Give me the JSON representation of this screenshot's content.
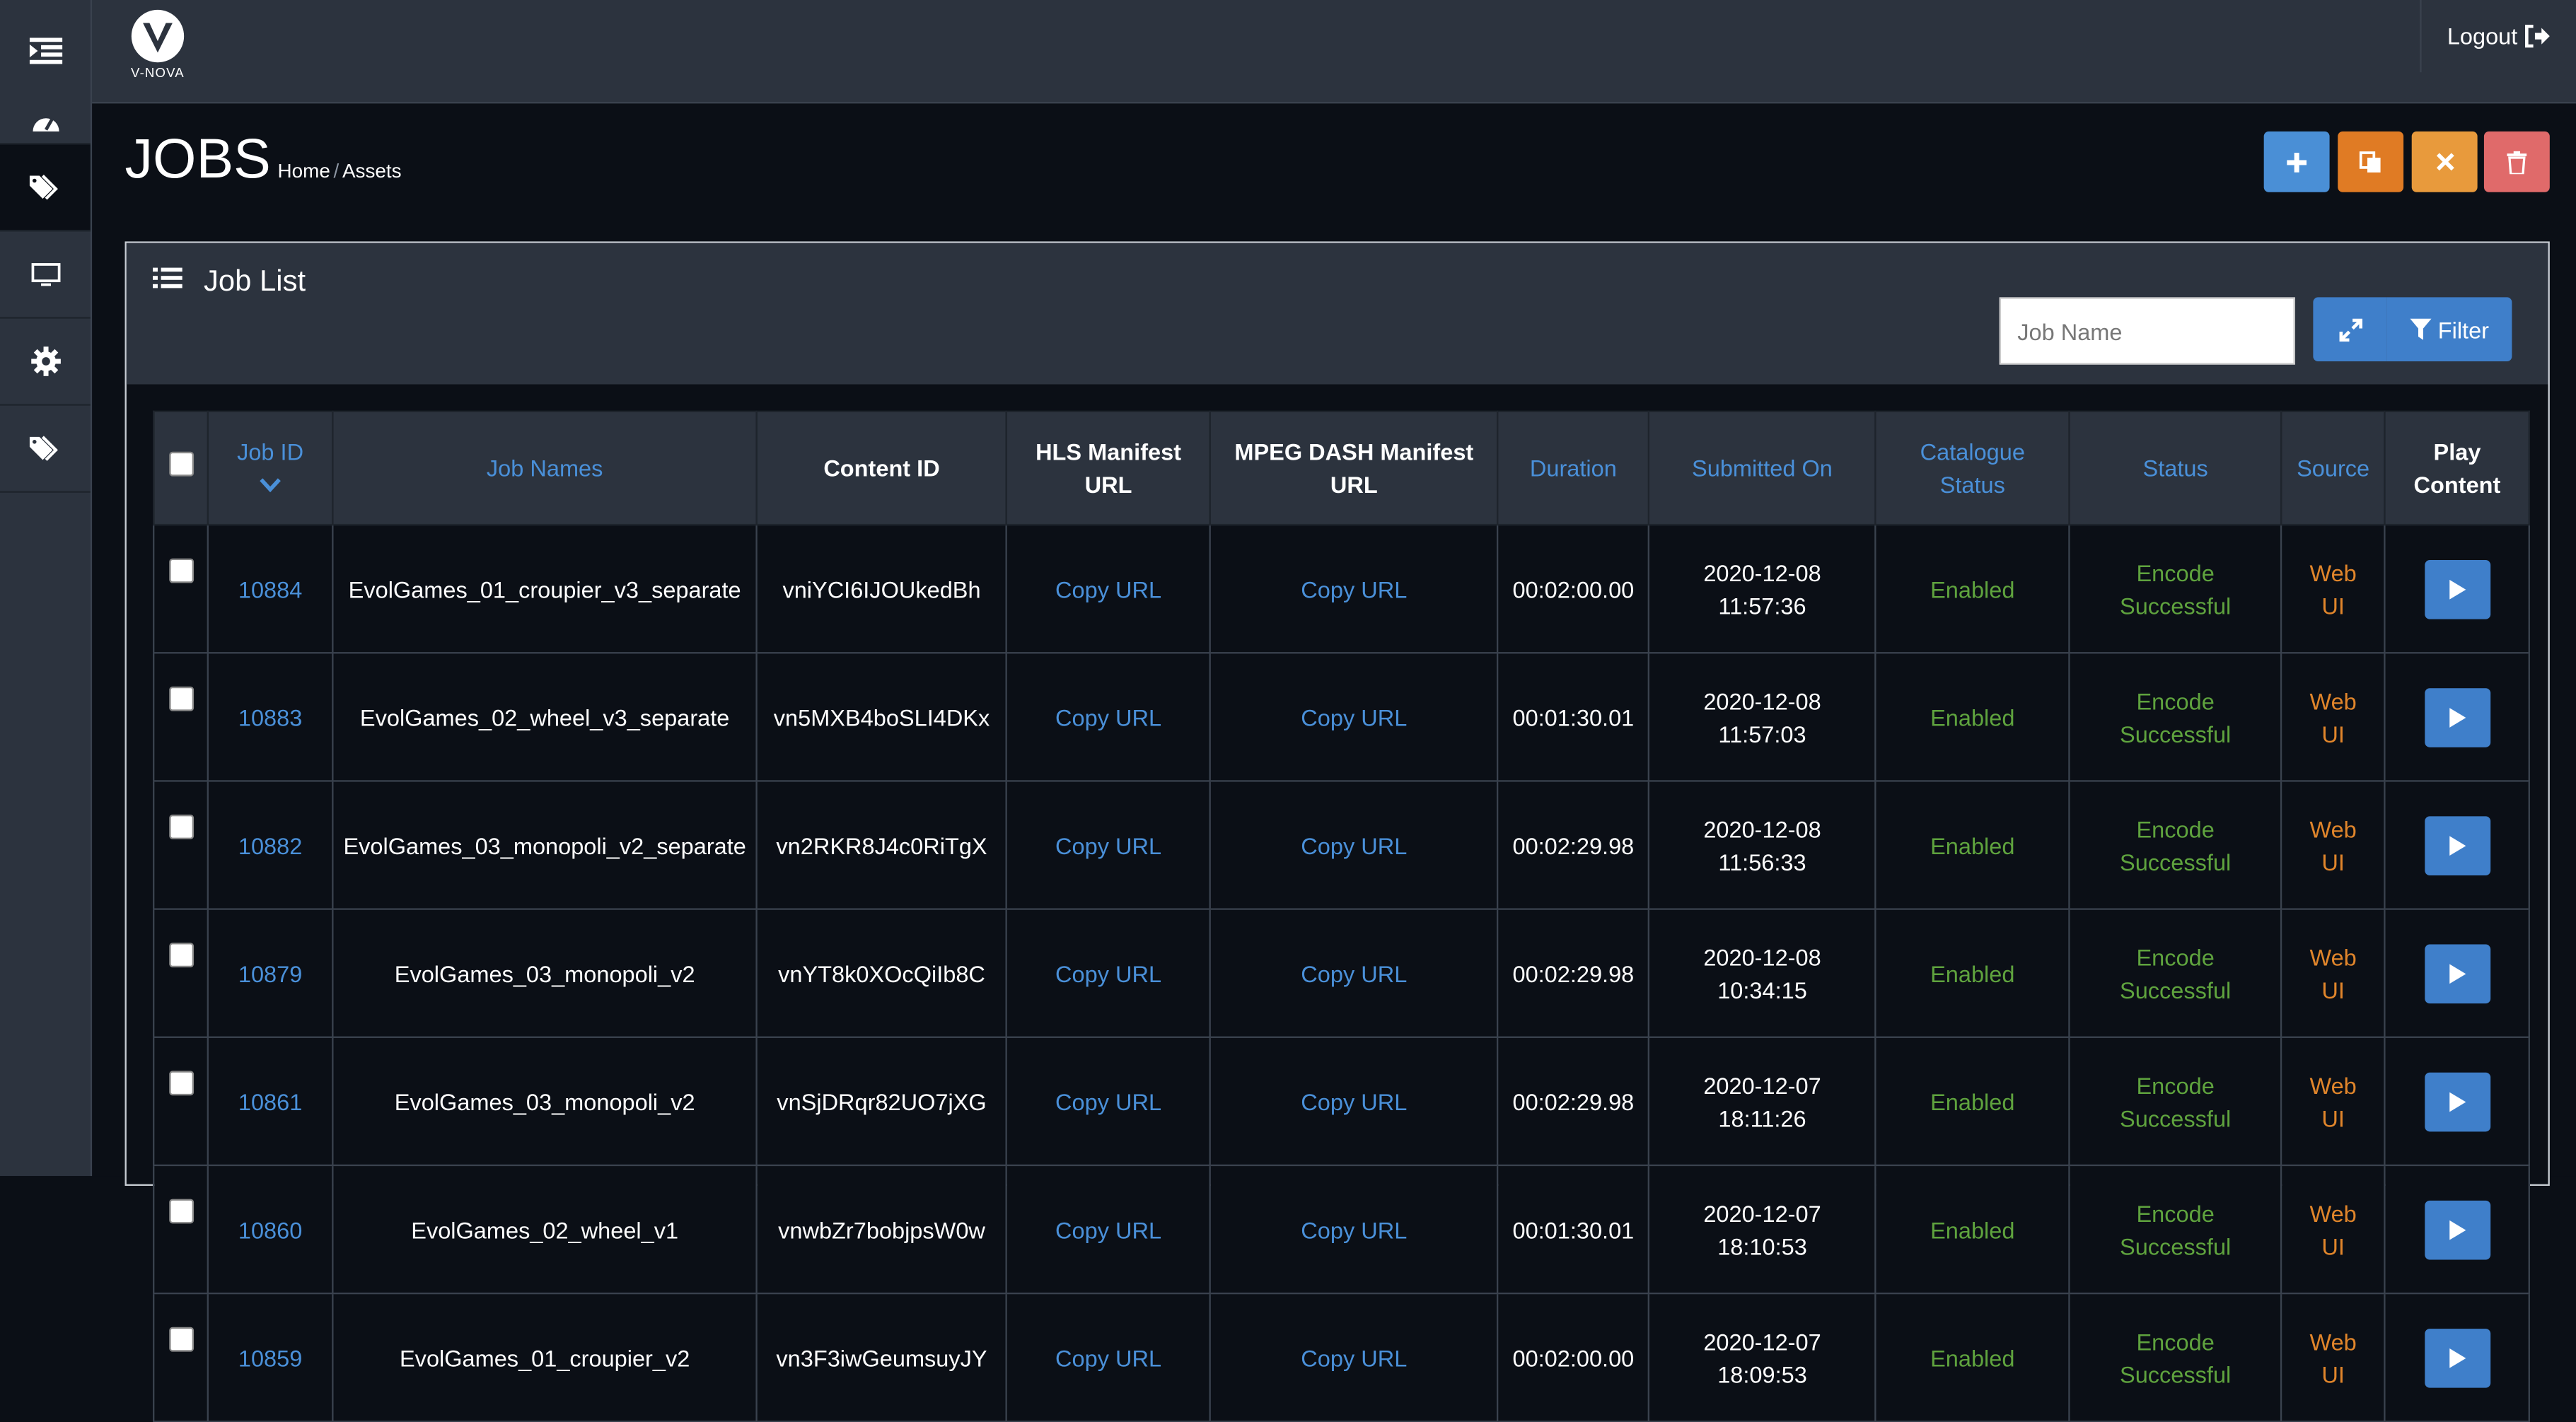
{
  "header": {
    "logo_text": "V-NOVA",
    "logout_label": "Logout"
  },
  "sidebar": {
    "items": [
      {
        "icon": "dashboard-icon"
      },
      {
        "icon": "tags-icon",
        "active": true
      },
      {
        "icon": "monitor-icon"
      },
      {
        "icon": "gear-icon"
      },
      {
        "icon": "tags-icon"
      }
    ]
  },
  "page": {
    "title": "JOBS",
    "breadcrumb": [
      "Home",
      "Assets"
    ]
  },
  "actions": {
    "add": {
      "icon": "plus-icon",
      "color": "#4a8fd6"
    },
    "copy": {
      "icon": "copy-icon",
      "color": "#e07b24"
    },
    "cancel": {
      "icon": "close-icon",
      "color": "#e89a3c"
    },
    "delete": {
      "icon": "trash-icon",
      "color": "#e06a6a"
    }
  },
  "panel": {
    "title": "Job List",
    "search_placeholder": "Job Name",
    "filter_label": "Filter"
  },
  "table": {
    "columns": {
      "job_id": "Job ID",
      "job_names": "Job Names",
      "content_id": "Content ID",
      "hls_l1": "HLS Manifest",
      "hls_l2": "URL",
      "dash_l1": "MPEG DASH Manifest",
      "dash_l2": "URL",
      "duration": "Duration",
      "submitted": "Submitted On",
      "catalogue_l1": "Catalogue",
      "catalogue_l2": "Status",
      "status": "Status",
      "source": "Source",
      "play_l1": "Play",
      "play_l2": "Content"
    },
    "rows": [
      {
        "id": "10884",
        "name": "EvolGames_01_croupier_v3_separate",
        "content_id": "vniYCI6IJOUkedBh",
        "hls": "Copy URL",
        "dash": "Copy URL",
        "duration": "00:02:00.00",
        "date": "2020-12-08",
        "time": "11:57:36",
        "catalogue": "Enabled",
        "status_l1": "Encode",
        "status_l2": "Successful",
        "source_l1": "Web",
        "source_l2": "UI"
      },
      {
        "id": "10883",
        "name": "EvolGames_02_wheel_v3_separate",
        "content_id": "vn5MXB4boSLI4DKx",
        "hls": "Copy URL",
        "dash": "Copy URL",
        "duration": "00:01:30.01",
        "date": "2020-12-08",
        "time": "11:57:03",
        "catalogue": "Enabled",
        "status_l1": "Encode",
        "status_l2": "Successful",
        "source_l1": "Web",
        "source_l2": "UI"
      },
      {
        "id": "10882",
        "name": "EvolGames_03_monopoli_v2_separate",
        "content_id": "vn2RKR8J4c0RiTgX",
        "hls": "Copy URL",
        "dash": "Copy URL",
        "duration": "00:02:29.98",
        "date": "2020-12-08",
        "time": "11:56:33",
        "catalogue": "Enabled",
        "status_l1": "Encode",
        "status_l2": "Successful",
        "source_l1": "Web",
        "source_l2": "UI"
      },
      {
        "id": "10879",
        "name": "EvolGames_03_monopoli_v2",
        "content_id": "vnYT8k0XOcQiIb8C",
        "hls": "Copy URL",
        "dash": "Copy URL",
        "duration": "00:02:29.98",
        "date": "2020-12-08",
        "time": "10:34:15",
        "catalogue": "Enabled",
        "status_l1": "Encode",
        "status_l2": "Successful",
        "source_l1": "Web",
        "source_l2": "UI"
      },
      {
        "id": "10861",
        "name": "EvolGames_03_monopoli_v2",
        "content_id": "vnSjDRqr82UO7jXG",
        "hls": "Copy URL",
        "dash": "Copy URL",
        "duration": "00:02:29.98",
        "date": "2020-12-07",
        "time": "18:11:26",
        "catalogue": "Enabled",
        "status_l1": "Encode",
        "status_l2": "Successful",
        "source_l1": "Web",
        "source_l2": "UI"
      },
      {
        "id": "10860",
        "name": "EvolGames_02_wheel_v1",
        "content_id": "vnwbZr7bobjpsW0w",
        "hls": "Copy URL",
        "dash": "Copy URL",
        "duration": "00:01:30.01",
        "date": "2020-12-07",
        "time": "18:10:53",
        "catalogue": "Enabled",
        "status_l1": "Encode",
        "status_l2": "Successful",
        "source_l1": "Web",
        "source_l2": "UI"
      },
      {
        "id": "10859",
        "name": "EvolGames_01_croupier_v2",
        "content_id": "vn3F3iwGeumsuyJY",
        "hls": "Copy URL",
        "dash": "Copy URL",
        "duration": "00:02:00.00",
        "date": "2020-12-07",
        "time": "18:09:53",
        "catalogue": "Enabled",
        "status_l1": "Encode",
        "status_l2": "Successful",
        "source_l1": "Web",
        "source_l2": "UI"
      }
    ]
  }
}
